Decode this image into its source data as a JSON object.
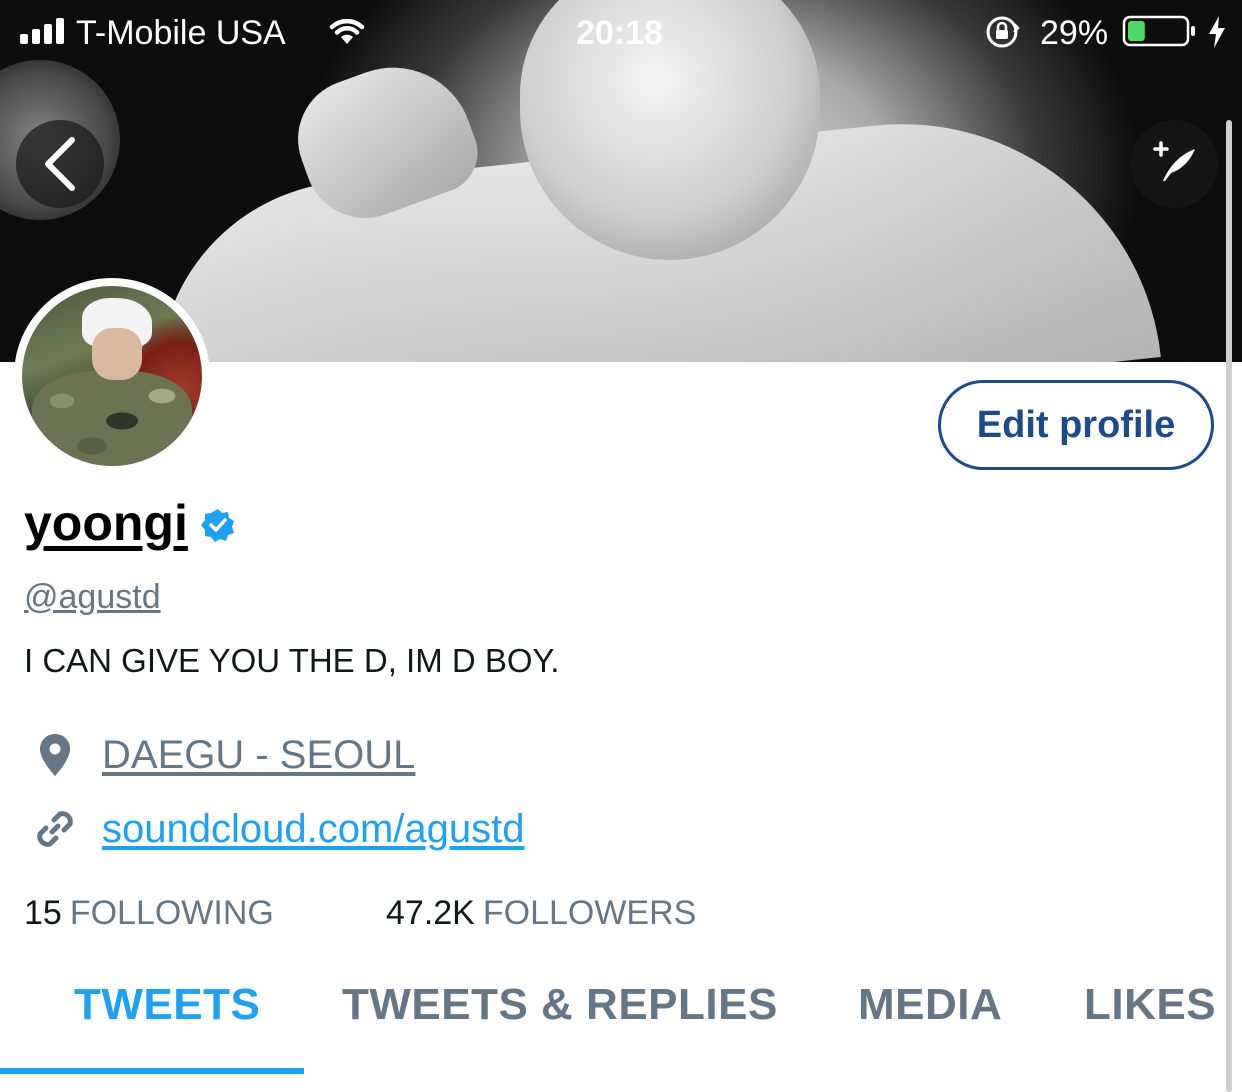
{
  "status_bar": {
    "carrier": "T-Mobile USA",
    "time": "20:18",
    "battery_percent": "29%",
    "battery_level": 0.29,
    "battery_color": "#4cd964",
    "icons": [
      "signal-icon",
      "wifi-icon",
      "rotation-lock-icon",
      "battery-icon",
      "charging-icon"
    ]
  },
  "header": {
    "back_icon": "chevron-left-icon",
    "compose_icon": "compose-tweet-icon"
  },
  "profile": {
    "display_name": "yoongi",
    "verified": true,
    "handle": "@agustd",
    "bio": "I CAN GIVE YOU THE D, IM D BOY.",
    "location": "DAEGU - SEOUL",
    "website": "soundcloud.com/agustd",
    "edit_button_label": "Edit profile"
  },
  "stats": {
    "following_count": "15",
    "following_label": "FOLLOWING",
    "followers_count": "47.2K",
    "followers_label": "FOLLOWERS"
  },
  "tabs": [
    {
      "label": "TWEETS",
      "active": true
    },
    {
      "label": "TWEETS & REPLIES",
      "active": false
    },
    {
      "label": "MEDIA",
      "active": false
    },
    {
      "label": "LIKES",
      "active": false
    }
  ],
  "colors": {
    "accent": "#1da1f2",
    "muted": "#657786",
    "edit_button": "#1b4a8d"
  }
}
